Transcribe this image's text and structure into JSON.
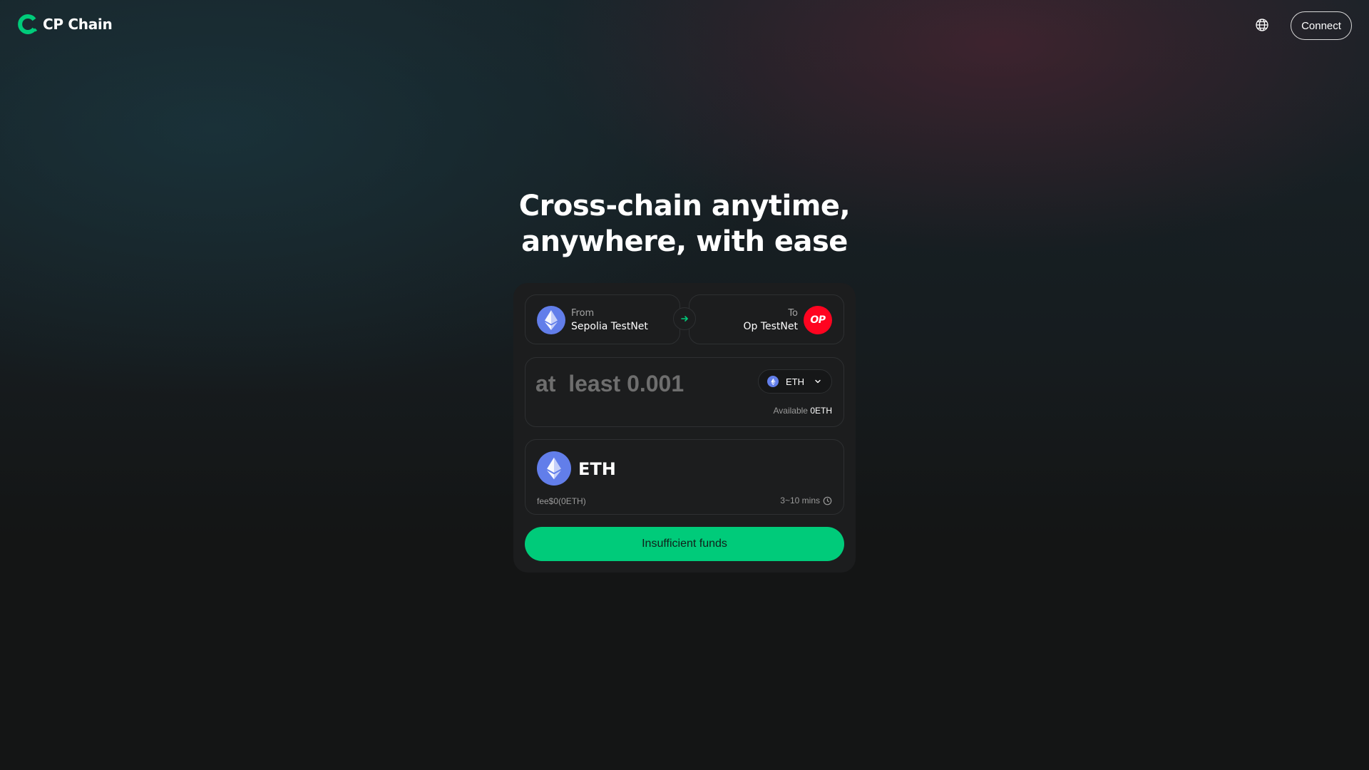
{
  "brand": {
    "name": "CP Chain",
    "accent": "#00cb7a"
  },
  "header": {
    "language_icon": "globe-icon",
    "connect_label": "Connect"
  },
  "hero": {
    "title": "Cross-chain anytime, anywhere, with ease"
  },
  "bridge": {
    "from": {
      "caption": "From",
      "network": "Sepolia TestNet",
      "icon": "ethereum-icon"
    },
    "to": {
      "caption": "To",
      "network": "Op TestNet",
      "icon_text": "OP"
    },
    "swap_icon": "arrow-right-icon",
    "amount": {
      "value": "",
      "placeholder": "at  least 0.001"
    },
    "token": {
      "symbol": "ETH",
      "icon": "ethereum-icon"
    },
    "available": {
      "label": "Available",
      "value": "0ETH"
    },
    "receive": {
      "token": "ETH",
      "fee": "fee$0(0ETH)",
      "time": "3~10 mins",
      "time_icon": "clock-icon"
    },
    "submit_label": "Insufficient funds"
  }
}
